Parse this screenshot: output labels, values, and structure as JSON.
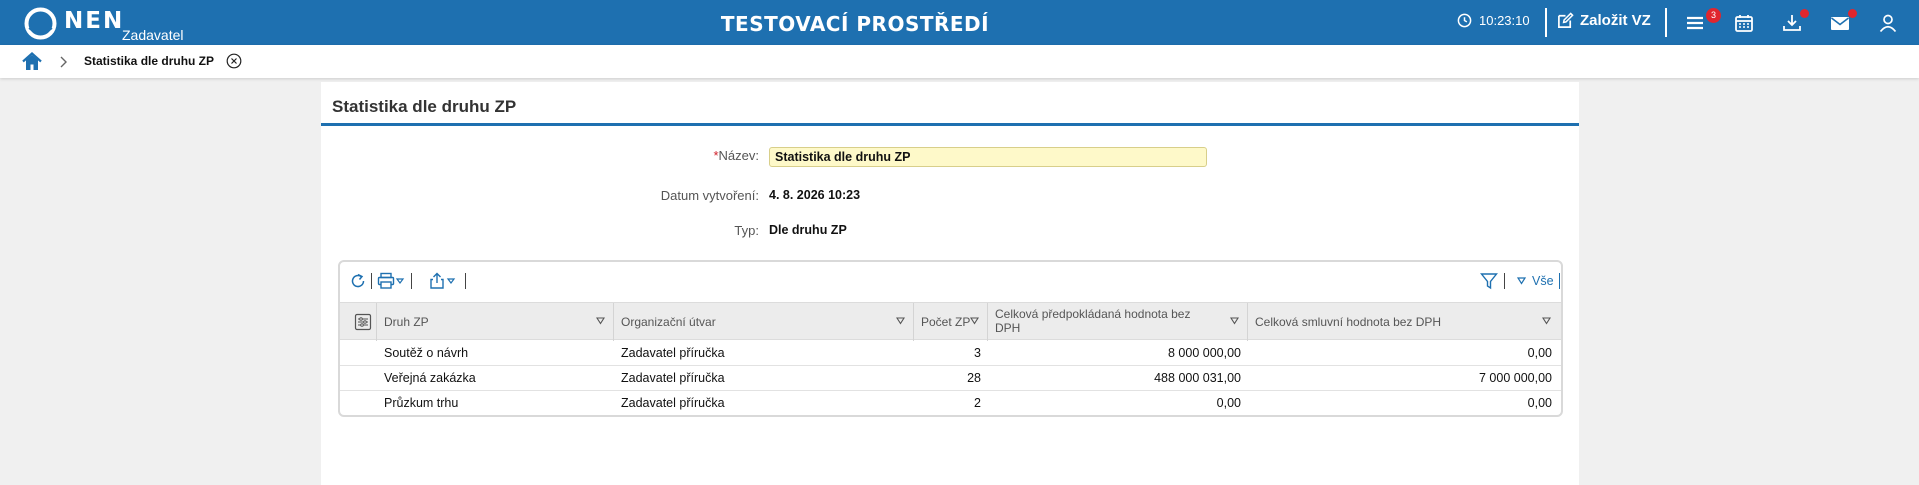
{
  "header": {
    "logo_text": "NEN",
    "logo_sub": "Zadavatel",
    "environment_title": "TESTOVACÍ PROSTŘEDÍ",
    "clock": "10:23:10",
    "create_button": "Založit VZ",
    "menu_badge": "3",
    "brand_color": "#1e70b0",
    "badge_color": "#e0262e"
  },
  "breadcrumb": {
    "current": "Statistika dle druhu ZP"
  },
  "panel": {
    "title": "Statistika dle druhu ZP"
  },
  "form": {
    "name_label": "Název:",
    "name_required_mark": "*",
    "name_value": "Statistika dle druhu ZP",
    "created_label": "Datum vytvoření:",
    "created_value": "4. 8. 2026 10:23",
    "type_label": "Typ:",
    "type_value": "Dle druhu ZP"
  },
  "grid": {
    "filter_all_label": "Vše",
    "columns": [
      "Druh ZP",
      "Organizační útvar",
      "Počet ZP",
      "Celková předpokládaná hodnota bez DPH",
      "Celková smluvní hodnota bez DPH"
    ],
    "rows": [
      [
        "Soutěž o návrh",
        "Zadavatel příručka",
        "3",
        "8 000 000,00",
        "0,00"
      ],
      [
        "Veřejná zakázka",
        "Zadavatel příručka",
        "28",
        "488 000 031,00",
        "7 000 000,00"
      ],
      [
        "Průzkum trhu",
        "Zadavatel příručka",
        "2",
        "0,00",
        "0,00"
      ]
    ]
  }
}
